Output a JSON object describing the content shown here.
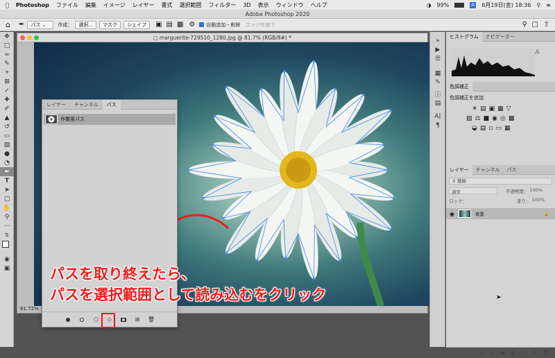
{
  "menubar": {
    "app": "Photoshop",
    "items": [
      "ファイル",
      "編集",
      "イメージ",
      "レイヤー",
      "書式",
      "選択範囲",
      "フィルター",
      "3D",
      "表示",
      "ウィンドウ",
      "ヘルプ"
    ],
    "battery": "99%",
    "datetime": "6月19日(金)  18:36"
  },
  "window_title": "Adobe Photoshop 2020",
  "options_bar": {
    "mode_value": "パス",
    "make_label": "作成：",
    "select_button": "選択...",
    "mask_button": "マスク",
    "shape_button": "シェイプ",
    "auto_add_delete": "自動追加・削除",
    "align_edges": "エッジを揃う"
  },
  "document": {
    "tab_title": "marguerite-729510_1280.jpg @ 81.7% (RGB/8#) *",
    "zoom": "81.72%"
  },
  "paths_panel": {
    "tabs": [
      "レイヤー",
      "チャンネル",
      "パス"
    ],
    "active_tab": "パス",
    "work_path": "作業用パス",
    "footer_icons": [
      "fill-path-icon",
      "stroke-path-icon",
      "load-path-as-selection-icon",
      "make-work-path-icon",
      "add-mask-icon",
      "new-path-icon",
      "delete-path-icon"
    ]
  },
  "instruction": {
    "line1": "パスを取り終えたら、",
    "line2": "パスを選択範囲として読み込むをクリック",
    "color": "#ef1b1b"
  },
  "right_panels": {
    "histogram_tabs": [
      "ヒストグラム",
      "ナビゲーター"
    ],
    "adjust_tab": "色調補正",
    "adjust_add": "色調補正を追加",
    "layers_tabs": [
      "レイヤー",
      "チャンネル",
      "パス"
    ],
    "kind_label": "種類",
    "blend_mode": "通常",
    "opacity_label": "不透明度：",
    "opacity_value": "100%",
    "lock_label": "ロック：",
    "fill_label": "塗り：",
    "fill_value": "100%",
    "layer_name": "背景"
  }
}
